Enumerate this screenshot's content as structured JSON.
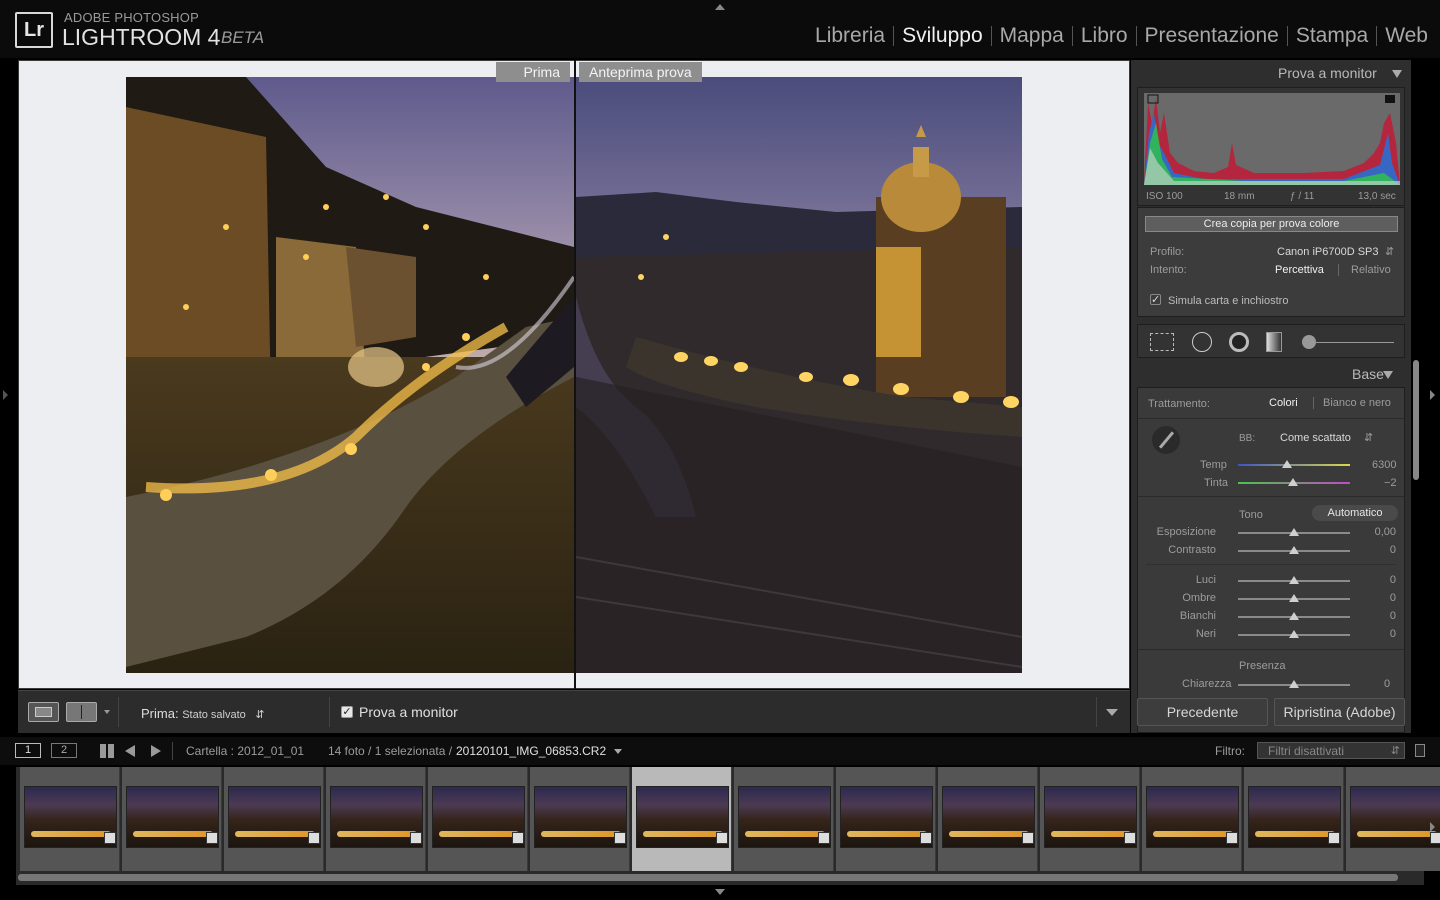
{
  "app": {
    "logo": "Lr",
    "vendor": "ADOBE PHOTOSHOP",
    "product": "LIGHTROOM 4",
    "edition": "BETA"
  },
  "modules": [
    {
      "label": "Libreria",
      "active": false
    },
    {
      "label": "Sviluppo",
      "active": true
    },
    {
      "label": "Mappa",
      "active": false
    },
    {
      "label": "Libro",
      "active": false
    },
    {
      "label": "Presentazione",
      "active": false
    },
    {
      "label": "Stampa",
      "active": false
    },
    {
      "label": "Web",
      "active": false
    }
  ],
  "view": {
    "before_tag": "Prima",
    "after_tag": "Anteprima prova"
  },
  "toolbar": {
    "prima_label": "Prima:",
    "prima_value": "Stato salvato",
    "softproof_label": "Prova a monitor",
    "softproof_checked": true
  },
  "right_panel": {
    "softproof_title": "Prova a monitor",
    "histogram": {
      "iso": "ISO 100",
      "focal": "18 mm",
      "aperture": "ƒ / 11",
      "shutter": "13,0 sec"
    },
    "create_copy_button": "Crea copia per prova colore",
    "profile_label": "Profilo:",
    "profile_value": "Canon iP6700D SP3",
    "intent_label": "Intento:",
    "intent_options": [
      "Percettiva",
      "Relativo"
    ],
    "simulate_label": "Simula carta e inchiostro",
    "simulate_checked": true,
    "base_title": "Base",
    "treatment_label": "Trattamento:",
    "treatment_options": [
      "Colori",
      "Bianco e nero"
    ],
    "wb_label": "BB:",
    "wb_value": "Come scattato",
    "temp_label": "Temp",
    "temp_value": "6300",
    "tint_label": "Tinta",
    "tint_value": "−2",
    "tone_label": "Tono",
    "auto_button": "Automatico",
    "sliders_tone": [
      {
        "label": "Esposizione",
        "value": "0,00"
      },
      {
        "label": "Contrasto",
        "value": "0"
      }
    ],
    "sliders_light": [
      {
        "label": "Luci",
        "value": "0"
      },
      {
        "label": "Ombre",
        "value": "0"
      },
      {
        "label": "Bianchi",
        "value": "0"
      },
      {
        "label": "Neri",
        "value": "0"
      }
    ],
    "presence_label": "Presenza",
    "clarity_label": "Chiarezza",
    "clarity_value": "0",
    "prev_button": "Precedente",
    "reset_button": "Ripristina (Adobe)"
  },
  "filmstrip_bar": {
    "screen1": "1",
    "screen2": "2",
    "folder_label": "Cartella : 2012_01_01",
    "count_label": "14 foto / 1 selezionata /",
    "filename": "20120101_IMG_06853.CR2",
    "filter_label": "Filtro:",
    "filter_value": "Filtri disattivati"
  },
  "filmstrip": {
    "count": 14,
    "selected_index": 6
  }
}
